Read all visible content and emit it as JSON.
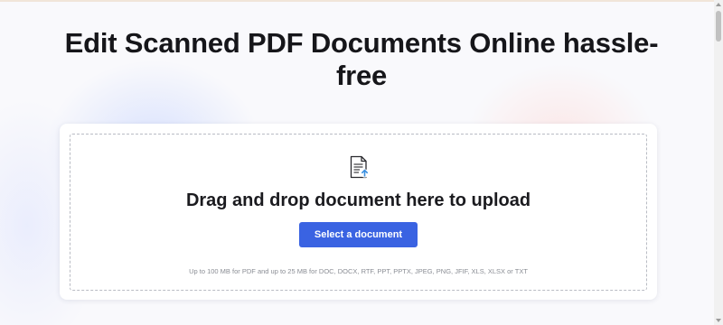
{
  "page": {
    "title": "Edit Scanned PDF Documents Online hassle-free"
  },
  "upload": {
    "headline": "Drag and drop document here to upload",
    "button_label": "Select a document",
    "limits_note": "Up to 100 MB for PDF and up to 25 MB for DOC, DOCX, RTF, PPT, PPTX, JPEG, PNG, JFIF, XLS, XLSX or TXT",
    "icon": "document-upload-icon"
  },
  "colors": {
    "accent": "#3a63e2",
    "title_text": "#16161a",
    "icon_arrow": "#3a8fe0"
  }
}
